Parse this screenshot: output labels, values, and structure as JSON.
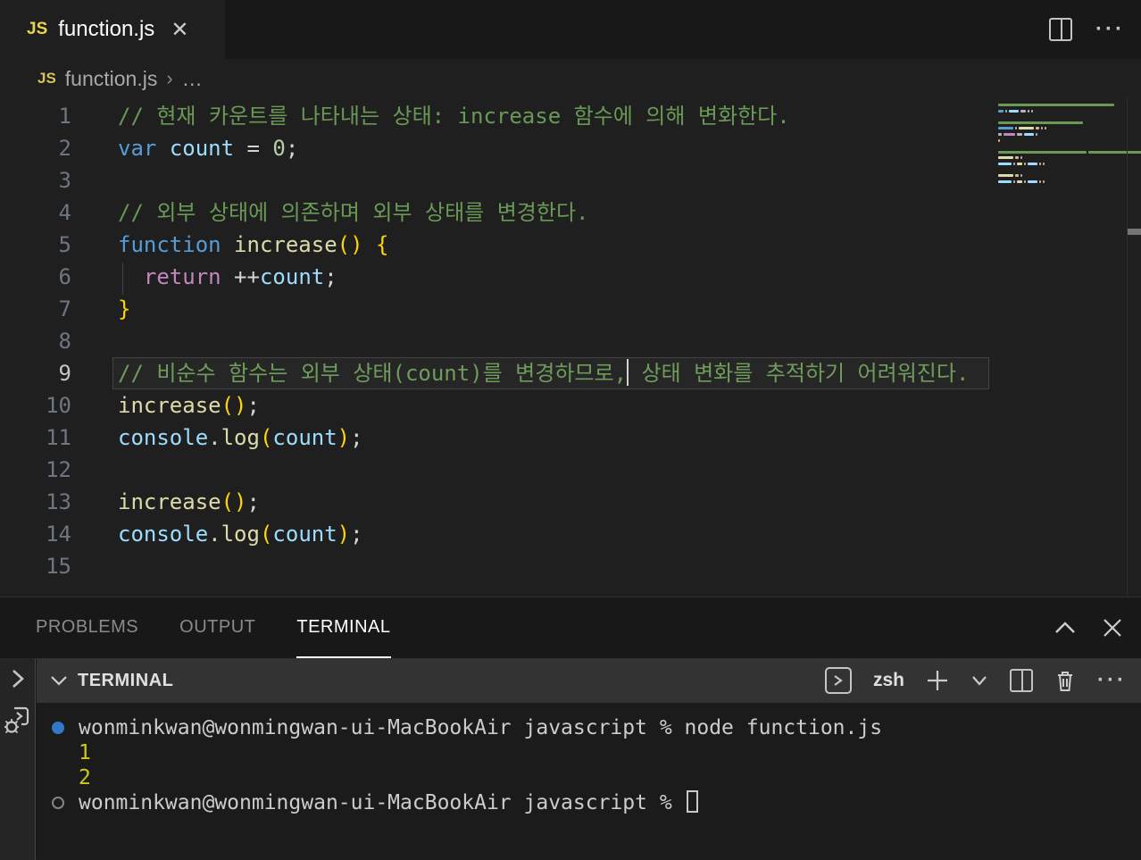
{
  "colors": {
    "editor_bg": "#1f1f1f",
    "tabstrip_bg": "#181818",
    "panel_header_bg": "#333333",
    "terminal_bg": "#1b1b1b",
    "comment": "#6A9955",
    "keyword": "#569CD6",
    "variable": "#9CDCFE",
    "function": "#DCDCAA",
    "control": "#C586C0",
    "number": "#B5CEA8",
    "bracket": "#FFD700",
    "text": "#d4d4d4",
    "prompt_dot_blue": "#3178c6",
    "terminal_yellow": "#cdcd15"
  },
  "tab_bar": {
    "tab": {
      "icon": "JS",
      "label": "function.js",
      "close": "✕"
    },
    "actions": {
      "split_icon": "split-editor",
      "more": "···"
    }
  },
  "breadcrumb": {
    "icon": "JS",
    "file": "function.js",
    "separator": "›",
    "more": "…"
  },
  "editor": {
    "active_line": 9,
    "lines": [
      {
        "n": 1,
        "tokens": [
          [
            "c",
            "// 현재 카운트를 나타내는 상태: increase 함수에 의해 변화한다."
          ]
        ]
      },
      {
        "n": 2,
        "tokens": [
          [
            "k",
            "var"
          ],
          [
            "p",
            " "
          ],
          [
            "v",
            "count"
          ],
          [
            "p",
            " = "
          ],
          [
            "n",
            "0"
          ],
          [
            "p",
            ";"
          ]
        ]
      },
      {
        "n": 3,
        "tokens": []
      },
      {
        "n": 4,
        "tokens": [
          [
            "c",
            "// 외부 상태에 의존하며 외부 상태를 변경한다."
          ]
        ]
      },
      {
        "n": 5,
        "tokens": [
          [
            "k",
            "function"
          ],
          [
            "p",
            " "
          ],
          [
            "f",
            "increase"
          ],
          [
            "g",
            "()"
          ],
          [
            "p",
            " "
          ],
          [
            "g",
            "{"
          ]
        ]
      },
      {
        "n": 6,
        "tokens": [
          [
            "p",
            "  "
          ],
          [
            "ctl",
            "return"
          ],
          [
            "p",
            " ++"
          ],
          [
            "v",
            "count"
          ],
          [
            "p",
            ";"
          ]
        ]
      },
      {
        "n": 7,
        "tokens": [
          [
            "g",
            "}"
          ]
        ]
      },
      {
        "n": 8,
        "tokens": []
      },
      {
        "n": 9,
        "tokens": [
          [
            "c",
            "// 비순수 함수는 외부 상태(count)를 변경하므로,"
          ],
          [
            "caret",
            ""
          ],
          [
            "c",
            " 상태 변화를 추적하기 어려워진다."
          ]
        ]
      },
      {
        "n": 10,
        "tokens": [
          [
            "f",
            "increase"
          ],
          [
            "g",
            "()"
          ],
          [
            "p",
            ";"
          ]
        ]
      },
      {
        "n": 11,
        "tokens": [
          [
            "v",
            "console"
          ],
          [
            "p",
            "."
          ],
          [
            "f",
            "log"
          ],
          [
            "g",
            "("
          ],
          [
            "v",
            "count"
          ],
          [
            "g",
            ")"
          ],
          [
            "p",
            ";"
          ]
        ]
      },
      {
        "n": 12,
        "tokens": []
      },
      {
        "n": 13,
        "tokens": [
          [
            "f",
            "increase"
          ],
          [
            "g",
            "()"
          ],
          [
            "p",
            ";"
          ]
        ]
      },
      {
        "n": 14,
        "tokens": [
          [
            "v",
            "console"
          ],
          [
            "p",
            "."
          ],
          [
            "f",
            "log"
          ],
          [
            "g",
            "("
          ],
          [
            "v",
            "count"
          ],
          [
            "g",
            ")"
          ],
          [
            "p",
            ";"
          ]
        ]
      },
      {
        "n": 15,
        "tokens": []
      }
    ]
  },
  "panel": {
    "tabs": [
      {
        "label": "PROBLEMS",
        "active": false
      },
      {
        "label": "OUTPUT",
        "active": false
      },
      {
        "label": "TERMINAL",
        "active": true
      }
    ],
    "actions": {
      "maximize": "chevron-up",
      "close": "✕"
    }
  },
  "terminal": {
    "header": {
      "title": "TERMINAL",
      "shell_label": "zsh",
      "icons": [
        "launch-profile",
        "new-terminal",
        "dropdown",
        "split-terminal",
        "kill-terminal",
        "more"
      ]
    },
    "lines": [
      {
        "marker": "filled",
        "text": "wonminkwan@wonmingwan-ui-MacBookAir javascript % node function.js",
        "color": ""
      },
      {
        "marker": "",
        "text": "1",
        "color": "yellow"
      },
      {
        "marker": "",
        "text": "2",
        "color": "yellow"
      },
      {
        "marker": "hollow",
        "text": "wonminkwan@wonmingwan-ui-MacBookAir javascript % ",
        "color": "",
        "cursor": true
      }
    ]
  }
}
